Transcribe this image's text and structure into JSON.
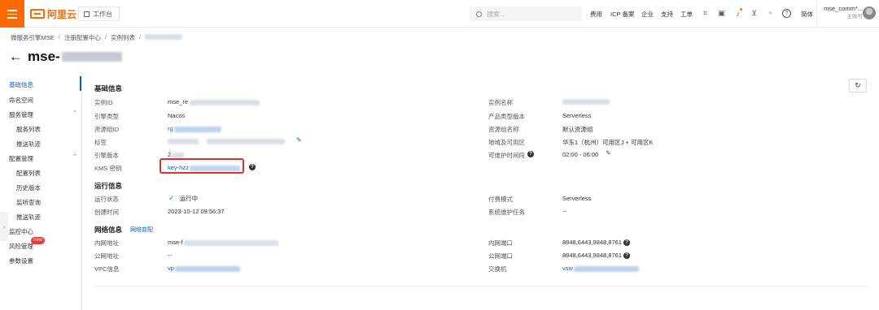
{
  "topbar": {
    "logo_text": "阿里云",
    "workbench": "工作台",
    "search_placeholder": "搜索...",
    "nav": [
      "费用",
      "ICP 备案",
      "企业",
      "支持",
      "工单"
    ],
    "lang": "简体",
    "account_name": "mse_comm*...",
    "account_role": "主账号",
    "accent": "#ff6a00"
  },
  "breadcrumb": [
    "微服务引擎MSE",
    "注册配置中心",
    "实例列表"
  ],
  "page": {
    "title": "mse-"
  },
  "sidebar": {
    "items": {
      "basic_info": "基础信息",
      "namespace": "命名空间",
      "service_mgmt": "服务管理",
      "service_list": "服务列表",
      "push_trace_1": "推送轨迹",
      "config_mgmt": "配置管理",
      "config_list": "配置列表",
      "history": "历史版本",
      "listener_query": "监听查询",
      "push_trace_2": "推送轨迹",
      "monitor": "监控中心",
      "risk_mgmt": "风险管理",
      "params": "参数设置"
    },
    "new_badge": "new"
  },
  "basic": {
    "title": "基础信息",
    "instance_id_label": "实例ID",
    "instance_id": "mse_re",
    "engine_type_label": "引擎类型",
    "engine_type": "Nacos",
    "resource_group_id_label": "资源组ID",
    "resource_group_id": "rg",
    "tags_label": "标签",
    "engine_version_label": "引擎版本",
    "engine_version": "2.",
    "kms_label": "KMS 密钥",
    "kms": "key-hzz",
    "instance_name_label": "实例名称",
    "product_version_label": "产品类型版本",
    "product_version": "Serverless",
    "resource_group_name_label": "资源组名称",
    "resource_group_name": "默认资源组",
    "region_label": "地域及可用区",
    "region": "华东1（杭州）可用区J + 可用区K",
    "maintenance_label": "可维护时间段",
    "maintenance": "02:00 - 06:00"
  },
  "runtime": {
    "title": "运行信息",
    "status_label": "运行状态",
    "status": "运行中",
    "created_label": "创建时间",
    "created": "2023-10-12 09:56:37",
    "billing_label": "付费模式",
    "billing": "Serverless",
    "maint_task_label": "系统维护任务",
    "maint_task": "--"
  },
  "network": {
    "title": "网络信息",
    "change_link": "网络变配",
    "internal_addr_label": "内网地址",
    "internal_addr": "mse-f",
    "public_addr_label": "公网地址",
    "public_addr": "--",
    "vpc_label": "VPC信息",
    "vpc": "vp",
    "internal_port_label": "内网端口",
    "internal_port": "8848,6443,9848,8761",
    "public_port_label": "公网端口",
    "public_port": "8848,6443,9848,8761",
    "switch_label": "交换机",
    "switch": "vsw"
  }
}
